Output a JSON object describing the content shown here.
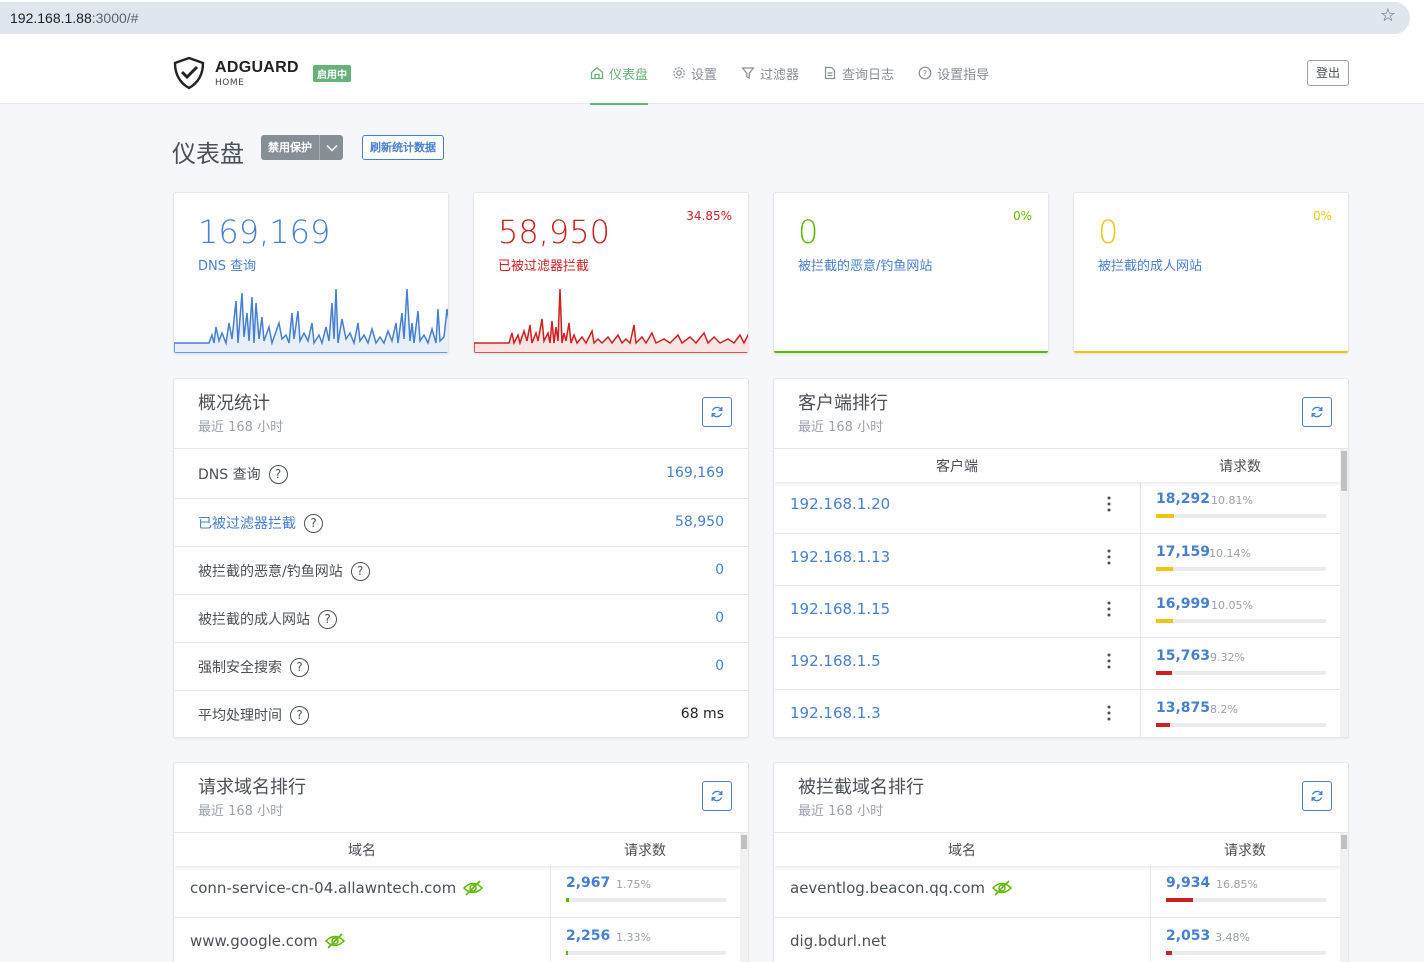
{
  "browser": {
    "url_host": "192.168.1.88",
    "url_rest": ":3000/#"
  },
  "header": {
    "brand": "ADGUARD",
    "brand_sub": "HOME",
    "status_badge": "启用中",
    "logout": "登出",
    "nav": [
      {
        "label": "仪表盘",
        "icon": "home-icon",
        "active": true
      },
      {
        "label": "设置",
        "icon": "gear-icon"
      },
      {
        "label": "过滤器",
        "icon": "filter-icon"
      },
      {
        "label": "查询日志",
        "icon": "log-icon"
      },
      {
        "label": "设置指导",
        "icon": "help-icon"
      }
    ]
  },
  "page": {
    "title": "仪表盘",
    "disable_protection": "禁用保护",
    "refresh_stats": "刷新统计数据"
  },
  "colors": {
    "blue": "#467fcf",
    "red": "#cd201f",
    "green": "#5eba00",
    "yellow": "#f1c40f",
    "accent": "#67b279"
  },
  "stats": [
    {
      "value": "169,169",
      "label": "DNS 查询",
      "percent": ""
    },
    {
      "value": "58,950",
      "label": "已被过滤器拦截",
      "percent": "34.85%"
    },
    {
      "value": "0",
      "label": "被拦截的恶意/钓鱼网站",
      "percent": "0%"
    },
    {
      "value": "0",
      "label": "被拦截的成人网站",
      "percent": "0%"
    }
  ],
  "overview": {
    "title": "概况统计",
    "subtitle": "最近 168 小时",
    "rows": [
      {
        "label": "DNS 查询",
        "value": "169,169"
      },
      {
        "label": "已被过滤器拦截",
        "value": "58,950"
      },
      {
        "label": "被拦截的恶意/钓鱼网站",
        "value": "0"
      },
      {
        "label": "被拦截的成人网站",
        "value": "0"
      },
      {
        "label": "强制安全搜索",
        "value": "0"
      },
      {
        "label": "平均处理时间",
        "value": "68 ms"
      }
    ]
  },
  "clients": {
    "title": "客户端排行",
    "subtitle": "最近 168 小时",
    "col_client": "客户端",
    "col_requests": "请求数",
    "rows": [
      {
        "name": "192.168.1.20",
        "count": "18,292",
        "pct": "10.81%",
        "fill": 0.108
      },
      {
        "name": "192.168.1.13",
        "count": "17,159",
        "pct": "10.14%",
        "fill": 0.101
      },
      {
        "name": "192.168.1.15",
        "count": "16,999",
        "pct": "10.05%",
        "fill": 0.1
      },
      {
        "name": "192.168.1.5",
        "count": "15,763",
        "pct": "9.32%",
        "fill": 0.093
      },
      {
        "name": "192.168.1.3",
        "count": "13,875",
        "pct": "8.2%",
        "fill": 0.082
      }
    ]
  },
  "top_domains": {
    "title": "请求域名排行",
    "subtitle": "最近 168 小时",
    "col_domain": "域名",
    "col_requests": "请求数",
    "rows": [
      {
        "name": "conn-service-cn-04.allawntech.com",
        "count": "2,967",
        "pct": "1.75%",
        "fill": 0.0175
      },
      {
        "name": "www.google.com",
        "count": "2,256",
        "pct": "1.33%",
        "fill": 0.0133
      }
    ]
  },
  "blocked_domains": {
    "title": "被拦截域名排行",
    "subtitle": "最近 168 小时",
    "col_domain": "域名",
    "col_requests": "请求数",
    "rows": [
      {
        "name": "aeventlog.beacon.qq.com",
        "count": "9,934",
        "pct": "16.85%",
        "fill": 0.1685
      },
      {
        "name": "dig.bdurl.net",
        "count": "2,053",
        "pct": "3.48%",
        "fill": 0.0348
      }
    ]
  }
}
